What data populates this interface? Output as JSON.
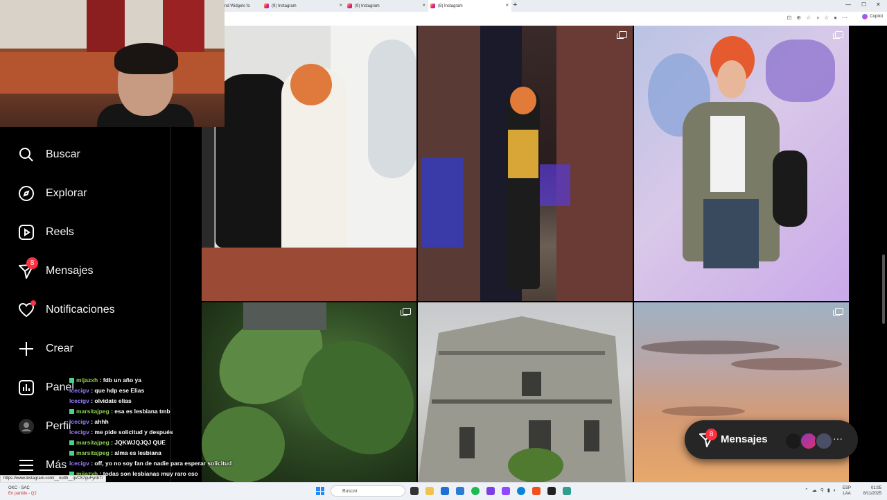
{
  "browser": {
    "tabs": [
      {
        "label": "nd Widgets fo",
        "active": false
      },
      {
        "label": "(9) Instagram",
        "active": false
      },
      {
        "label": "(9) Instagram",
        "active": false
      },
      {
        "label": "(8) Instagram",
        "active": true
      }
    ],
    "copilot_label": "Copilot"
  },
  "sidebar": {
    "items": [
      {
        "label": "Buscar",
        "icon": "search-icon"
      },
      {
        "label": "Explorar",
        "icon": "compass-icon"
      },
      {
        "label": "Reels",
        "icon": "reels-icon"
      },
      {
        "label": "Mensajes",
        "icon": "messenger-icon",
        "badge": "8"
      },
      {
        "label": "Notificaciones",
        "icon": "heart-icon"
      },
      {
        "label": "Crear",
        "icon": "plus-icon"
      },
      {
        "label": "Panel",
        "icon": "dashboard-icon"
      },
      {
        "label": "Perfil",
        "icon": "avatar-icon"
      },
      {
        "label": "Más",
        "icon": "menu-icon"
      }
    ]
  },
  "chat": [
    {
      "user": "mijazxh",
      "text": ": fdb un año ya",
      "color": "green"
    },
    {
      "user": "lcecigv",
      "text": ": que hdp ese Elias",
      "color": "purple"
    },
    {
      "user": "lcecigv",
      "text": ": olvidate elias",
      "color": "purple"
    },
    {
      "user": "marsitajpeg",
      "text": ": esa es lesbiana tmb",
      "color": "green"
    },
    {
      "user": "lcecigv",
      "text": ": ahhh",
      "color": "purple"
    },
    {
      "user": "lcecigv",
      "text": ": me pide solicitud y después",
      "color": "purple"
    },
    {
      "user": "marsitajpeg",
      "text": ": JQKWJQJQJ QUE",
      "color": "green"
    },
    {
      "user": "marsitajpeg",
      "text": ": alma es lesbiana",
      "color": "green"
    },
    {
      "user": "lcecigv",
      "text": ": off, yo no soy fan de nadie para esperar solicitud",
      "color": "purple"
    },
    {
      "user": "mijazxh",
      "text": ": todas son lesbianas muy raro eso",
      "color": "green"
    }
  ],
  "messages_pill": {
    "label": "Mensajes",
    "badge": "8"
  },
  "status_url": "https://www.instagram.com/__nutth__/p/C57guFyrdr7/",
  "taskbar": {
    "weather_line1": "OKC - SAC",
    "weather_line2": "En partido - Q2",
    "search_placeholder": "Buscar",
    "lang_line1": "ESP",
    "lang_line2": "LAA",
    "time": "01:05",
    "date": "8/11/2025"
  }
}
